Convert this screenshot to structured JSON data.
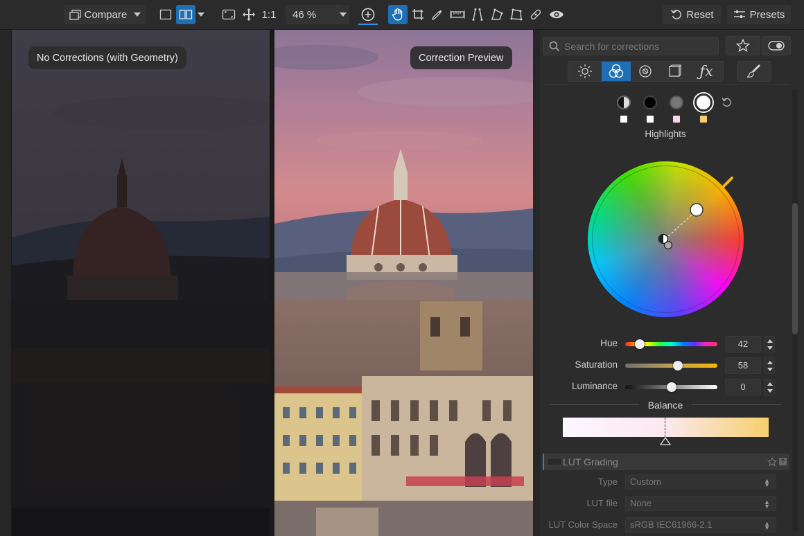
{
  "toolbar": {
    "compare_label": "Compare",
    "one_to_one": "1:1",
    "zoom": "46 %",
    "reset_label": "Reset",
    "presets_label": "Presets"
  },
  "viewer": {
    "before_label": "No Corrections (with Geometry)",
    "after_label": "Correction Preview"
  },
  "panel": {
    "search_placeholder": "Search for corrections",
    "tone_label": "Highlights",
    "sliders": [
      {
        "label": "Hue",
        "value": "42"
      },
      {
        "label": "Saturation",
        "value": "58"
      },
      {
        "label": "Luminance",
        "value": "0"
      }
    ],
    "balance_label": "Balance",
    "lut": {
      "title": "LUT Grading",
      "rows": [
        {
          "label": "Type",
          "value": "Custom"
        },
        {
          "label": "LUT file",
          "value": "None"
        },
        {
          "label": "LUT Color Space",
          "value": "sRGB IEC61966-2.1"
        }
      ]
    }
  },
  "colors": {
    "accent": "#1f6fb5",
    "highlight_swatch": "#f5cf6e",
    "shadow_swatch": "#ffffff",
    "midtone_swatch": "#f6d8ec"
  }
}
